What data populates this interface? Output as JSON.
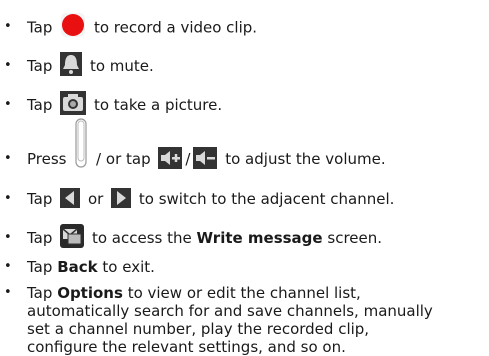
{
  "items": [
    {
      "pre": "Tap",
      "post": "to record a video clip.",
      "icon": "record-icon"
    },
    {
      "pre": "Tap",
      "post": "to mute.",
      "icon": "mute-bell-icon"
    },
    {
      "pre": "Tap",
      "post": "to take a picture.",
      "icon": "camera-icon"
    },
    {
      "pre": "Press",
      "mid1": "/",
      "mid2": "or tap",
      "mid3": "/",
      "post": "to adjust the volume.",
      "icons": [
        "side-volume-key-icon",
        "volume-up-icon",
        "volume-down-icon"
      ]
    },
    {
      "pre": "Tap",
      "mid": "or",
      "post": "to switch to the adjacent channel.",
      "icons": [
        "previous-channel-icon",
        "next-channel-icon"
      ]
    },
    {
      "pre": "Tap",
      "mid": "to access the",
      "bold": "Write message",
      "post": "screen.",
      "icon": "write-message-icon"
    },
    {
      "pre": "Tap",
      "bold": "Back",
      "post": "to exit."
    },
    {
      "pre": "Tap",
      "bold": "Options",
      "post": "to view or edit the channel list,",
      "cont": [
        "automatically search for and save channels, manually",
        "set a channel number, play the recorded clip,",
        "configure the relevant settings, and so on."
      ]
    }
  ],
  "colors": {
    "record": "#e81010",
    "icon_dark": "#222222",
    "icon_light": "#d9d9d9"
  }
}
